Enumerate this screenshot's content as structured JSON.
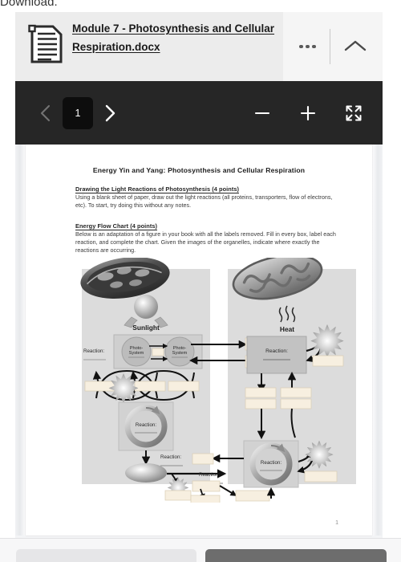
{
  "page": {
    "above_text": "Download."
  },
  "attachment": {
    "file_icon": "document-icon",
    "file_name": "Module 7 - Photosynthesis and Cellular Respiration.docx",
    "more_label": "•••",
    "more_icon": "ellipsis-icon",
    "collapse_icon": "chevron-up-icon"
  },
  "toolbar": {
    "prev_icon": "chevron-left-icon",
    "next_icon": "chevron-right-icon",
    "page_number": "1",
    "zoom_out_icon": "minus-icon",
    "zoom_in_icon": "plus-icon",
    "fullscreen_icon": "expand-arrows-icon",
    "background": "#262626"
  },
  "document": {
    "title": "Energy Yin and Yang:  Photosynthesis and Cellular Respiration",
    "sections": [
      {
        "heading": "Drawing the Light Reactions of Photosynthesis (4 points)",
        "body": "Using a blank sheet of paper, draw out the light reactions (all proteins, transporters, flow of electrons, etc).  To start, try doing this without any notes."
      },
      {
        "heading": "Energy Flow Chart (4 points)",
        "body": "Below is an adaptation of a figure in your book with all the labels removed.  Fill in every box, label each reaction, and complete the chart.  Given the images of the organelles, indicate where exactly the reactions are occurring."
      }
    ],
    "page_number": "1",
    "figure": {
      "labels": {
        "sunlight": "Sunlight",
        "heat": "Heat",
        "photosystem_1": "Photo-System",
        "photosystem_2": "Photo-System",
        "reaction_left_label": "Reaction:",
        "reaction_left_circle": "Reaction:",
        "reaction_left_lower": "Reaction:",
        "reaction_right_box": "Reaction:",
        "reaction_right_circle": "Reaction:",
        "reaction_right_lower": "Reaction:"
      },
      "organelles": [
        "chloroplast",
        "mitochondrion"
      ]
    }
  },
  "bottom_bar": {
    "primary_button": "",
    "secondary_button": ""
  },
  "colors": {
    "toolbar_bg": "#262626",
    "card_bg": "#f5f5f5",
    "file_zone_bg": "#ececec",
    "page_bg": "#ffffff",
    "surface_bg": "#f3f4f6",
    "blank_box": "#f7efe0",
    "panel_gray": "#d7d7d7"
  }
}
